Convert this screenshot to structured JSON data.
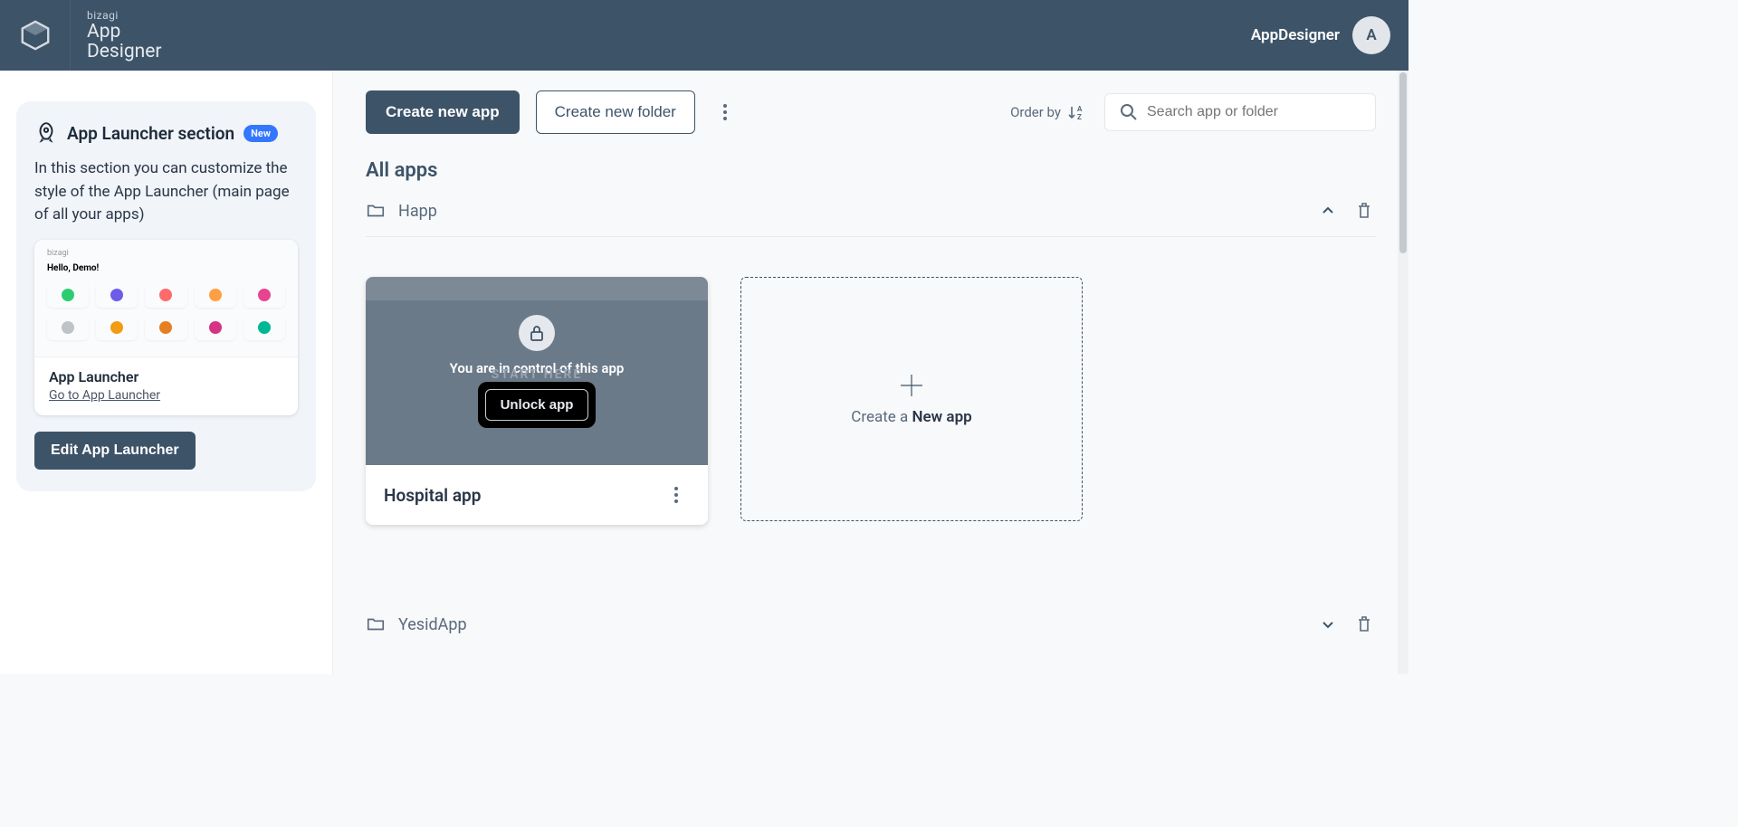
{
  "header": {
    "brand_small": "bizagi",
    "brand_line1": "App",
    "brand_line2": "Designer",
    "user_name": "AppDesigner",
    "avatar_initial": "A"
  },
  "sidebar": {
    "info_title": "App Launcher section",
    "badge": "New",
    "info_desc": "In this section you can customize the style of the App Launcher (main page of all your apps)",
    "preview": {
      "tiny_brand": "bizagi",
      "tiny_hello": "Hello, Demo!",
      "tile_colors": [
        "#2ecc71",
        "#6c5ce7",
        "#ff6b6b",
        "#ff9f43",
        "#e84393",
        "#bdc3c7",
        "#f39c12",
        "#e67e22",
        "#d63384",
        "#00b894"
      ],
      "footer_title": "App Launcher",
      "footer_link": "Go to App Launcher"
    },
    "edit_btn": "Edit App Launcher"
  },
  "toolbar": {
    "create_app": "Create new app",
    "create_folder": "Create new folder",
    "order_by_label": "Order by",
    "search_placeholder": "Search app or folder"
  },
  "content": {
    "section_title": "All apps",
    "folders": [
      {
        "name": "Happ",
        "expanded": true
      },
      {
        "name": "YesidApp",
        "expanded": false
      }
    ],
    "app_card": {
      "ghost_start": "START HERE",
      "control_text": "You are in control of this app",
      "unlock_label": "Unlock app",
      "name": "Hospital app"
    },
    "new_app_card": {
      "prefix": "Create a ",
      "bold": "New app"
    }
  }
}
